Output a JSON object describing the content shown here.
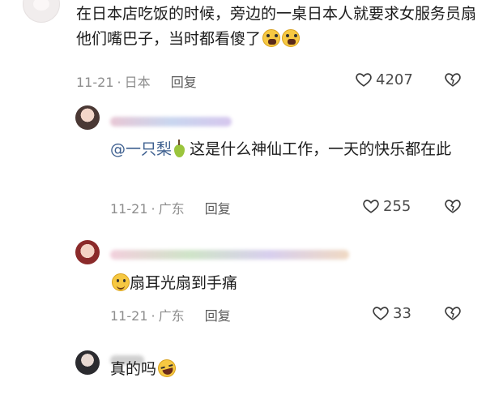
{
  "comments": {
    "main": {
      "text": "在日本店吃饭的时候，旁边的一桌日本人就要求女服务员扇他们嘴巴子，当时都看傻了",
      "emojis": [
        "scared-face-icon",
        "scared-face-icon"
      ],
      "date": "11-21",
      "location": "日本",
      "reply_label": "回复",
      "likes": "4207"
    },
    "reply_a": {
      "mention": "@一只梨",
      "text": "这是什么神仙工作，一天的快乐都在此",
      "emoji": "pear-icon",
      "date": "11-21",
      "location": "广东",
      "reply_label": "回复",
      "likes": "255"
    },
    "reply_b": {
      "emoji": "smiling-face-icon",
      "text": "扇耳光扇到手痛",
      "date": "11-21",
      "location": "广东",
      "reply_label": "回复",
      "likes": "33"
    },
    "reply_c": {
      "text": "真的吗",
      "emoji": "laughing-face-icon"
    }
  },
  "meta": {
    "separator": "·"
  },
  "colors": {
    "mention": "#3d5f8f",
    "meta_text": "#8e8e8e",
    "body_text": "#1b1b1b"
  }
}
